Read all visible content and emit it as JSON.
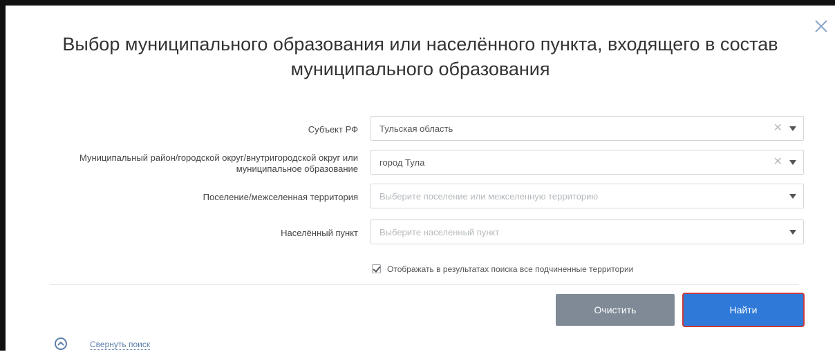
{
  "dialog": {
    "title": "Выбор муниципального образования или населённого пункта, входящего в состав муниципального образования"
  },
  "form": {
    "subject": {
      "label": "Субъект РФ",
      "value": "Тульская область"
    },
    "district": {
      "label": "Муниципальный район/городской округ/внутригородской округ или муниципальное образование",
      "value": "город Тула"
    },
    "settlement": {
      "label": "Поселение/межселенная территория",
      "placeholder": "Выберите поселение или межселенную территорию"
    },
    "locality": {
      "label": "Населённый пункт",
      "placeholder": "Выберите населенный пункт"
    },
    "show_subordinate": {
      "label": "Отображать в результатах поиска все подчиненные территории",
      "checked": true
    }
  },
  "actions": {
    "clear_label": "Очистить",
    "find_label": "Найти",
    "collapse_label": "Свернуть поиск"
  },
  "colors": {
    "primary": "#2f7ad8",
    "secondary": "#7f8a96",
    "link": "#5b7fa8",
    "highlight": "#c73a3a"
  },
  "icons": {
    "close": "close-icon",
    "clear": "clear-x-icon",
    "dropdown": "chevron-down-icon",
    "collapse": "chevron-up-circle-icon",
    "check": "checkmark-icon"
  }
}
